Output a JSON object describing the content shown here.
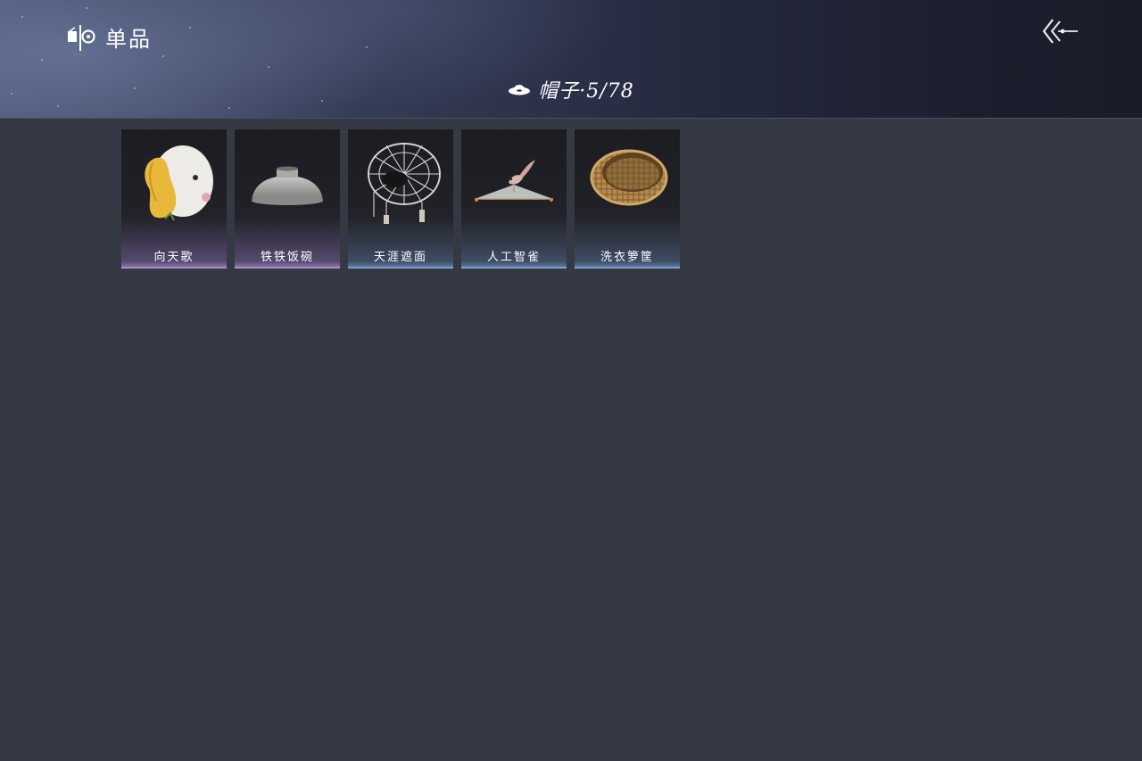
{
  "header": {
    "title": "单品",
    "title_icon": "wardrobe-icon",
    "back_icon": "back-arrow-icon"
  },
  "category": {
    "label": "帽子·5/78",
    "icon": "hat-icon"
  },
  "items": [
    {
      "name": "向天歌",
      "icon": "goose-hood-icon",
      "rarity_color": "#a88fc8"
    },
    {
      "name": "铁铁饭碗",
      "icon": "iron-bowl-icon",
      "rarity_color": "#a88fc8"
    },
    {
      "name": "天涯遮面",
      "icon": "bamboo-veil-hat-icon",
      "rarity_color": "#7f9fc8"
    },
    {
      "name": "人工智雀",
      "icon": "bird-hat-icon",
      "rarity_color": "#7f9fc8"
    },
    {
      "name": "洗衣箩筐",
      "icon": "wicker-basket-icon",
      "rarity_color": "#7f9fc8"
    }
  ]
}
